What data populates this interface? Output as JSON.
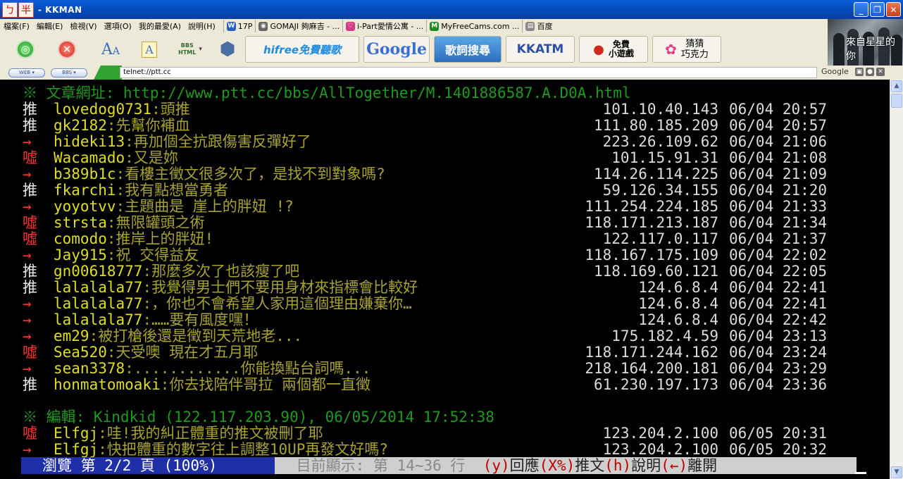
{
  "titlebar": {
    "ime": [
      "ㄅ",
      "半"
    ],
    "title": "- KKMAN",
    "buttons": [
      "_",
      "❐",
      "✕"
    ]
  },
  "menubar": {
    "items": [
      "檔案(F)",
      "編輯(E)",
      "檢視(V)",
      "選項(O)",
      "我的最愛(A)",
      "說明(H)"
    ],
    "favorites": [
      {
        "label": "17P",
        "icon": "W",
        "color": "#2a5fbf"
      },
      {
        "label": "GOMAJI 夠麻吉 - ...",
        "icon": "◉",
        "color": "#666666"
      },
      {
        "label": "i-Part愛情公寓 - ...",
        "icon": "♡",
        "color": "#d63b86"
      },
      {
        "label": "MyFreeCams.com ...",
        "icon": "M",
        "color": "#1f8a1f"
      },
      {
        "label": "百度",
        "icon": "▤",
        "color": "#888888"
      }
    ]
  },
  "toolbar": {
    "hifree": "hifree免費聽歌",
    "google": "Google",
    "lyrics": "歌詞搜尋",
    "kkatm": "KKATM",
    "game": "免費\n小遊戲",
    "guess": "猜猜\n巧克力",
    "bbs_html": "BBS\nHTML"
  },
  "promo": {
    "text": "來自星星的你"
  },
  "address": {
    "web_btn": "WEB ▾",
    "bbs_btn": "BBS ▾",
    "url": "telnet://ptt.cc",
    "search_label": "Google"
  },
  "terminal": {
    "url_line": "※ 文章網址: http://www.ptt.cc/bbs/AllTogether/M.1401886587.A.D0A.html",
    "pushes": [
      {
        "tag": "推",
        "user": "lovedog0731",
        "msg": ":頭推",
        "ip": "101.10.40.143",
        "dt": "06/04 20:57"
      },
      {
        "tag": "推",
        "user": "gk2182",
        "msg": ":先幫你補血",
        "ip": "111.80.185.209",
        "dt": "06/04 20:57"
      },
      {
        "tag": "→",
        "user": "hideki13",
        "msg": ":再加個全抗跟傷害反彈好了",
        "ip": "223.26.109.62",
        "dt": "06/04 21:06"
      },
      {
        "tag": "噓",
        "user": "Wacamado",
        "msg": ":又是妳",
        "ip": "101.15.91.31",
        "dt": "06/04 21:08"
      },
      {
        "tag": "→",
        "user": "b389b1c",
        "msg": ":看樓主徵文很多次了，是找不到對象嗎?",
        "ip": "114.26.114.225",
        "dt": "06/04 21:09"
      },
      {
        "tag": "推",
        "user": "fkarchi",
        "msg": ":我有點想當勇者",
        "ip": "59.126.34.155",
        "dt": "06/04 21:20"
      },
      {
        "tag": "→",
        "user": "yoyotvv",
        "msg": ":主題曲是 崖上的胖妞 !?",
        "ip": "111.254.224.185",
        "dt": "06/04 21:33"
      },
      {
        "tag": "噓",
        "user": "strsta",
        "msg": ":無限罐頭之術",
        "ip": "118.171.213.187",
        "dt": "06/04 21:34"
      },
      {
        "tag": "噓",
        "user": "comodo",
        "msg": ":推岸上的胖妞!",
        "ip": "122.117.0.117",
        "dt": "06/04 21:37"
      },
      {
        "tag": "→",
        "user": "Jay915",
        "msg": ":祝 交得益友",
        "ip": "118.167.175.109",
        "dt": "06/04 22:02"
      },
      {
        "tag": "推",
        "user": "gn00618777",
        "msg": ":那麼多次了也該瘦了吧",
        "ip": "118.169.60.121",
        "dt": "06/04 22:05"
      },
      {
        "tag": "推",
        "user": "lalalala77",
        "msg": ":我覺得男士們不要用身材來指標會比較好",
        "ip": "124.6.8.4",
        "dt": "06/04 22:41"
      },
      {
        "tag": "→",
        "user": "lalalala77",
        "msg": ":，你也不會希望人家用這個理由嫌棄你…",
        "ip": "124.6.8.4",
        "dt": "06/04 22:41"
      },
      {
        "tag": "→",
        "user": "lalalala77",
        "msg": ":……要有風度嘿！",
        "ip": "124.6.8.4",
        "dt": "06/04 22:42"
      },
      {
        "tag": "→",
        "user": "em29",
        "msg": ":被打槍後還是徵到天荒地老...",
        "ip": "175.182.4.59",
        "dt": "06/04 23:13"
      },
      {
        "tag": "噓",
        "user": "Sea520",
        "msg": ":天受噢 現在才五月耶",
        "ip": "118.171.244.162",
        "dt": "06/04 23:24"
      },
      {
        "tag": "→",
        "user": "sean3378",
        "msg": ":............你能換點台詞嗎...",
        "ip": "218.164.200.181",
        "dt": "06/04 23:29"
      },
      {
        "tag": "推",
        "user": "honmatomoaki",
        "msg": ":你去找陪伴哥拉 兩個都一直徵",
        "ip": "61.230.197.173",
        "dt": "06/04 23:36"
      }
    ],
    "edit_line": "※ 編輯: Kindkid (122.117.203.90), 06/05/2014 17:52:38",
    "pushes2": [
      {
        "tag": "噓",
        "user": "Elfgj",
        "msg": ":哇!我的糾正體重的推文被刪了耶",
        "ip": "123.204.2.100",
        "dt": "06/05 20:31"
      },
      {
        "tag": "→",
        "user": "Elfgj",
        "msg": ":快把體重的數字往上調整10UP再發文好嗎?",
        "ip": "123.204.2.100",
        "dt": "06/05 20:32"
      }
    ],
    "status_left": "瀏覽 第 2/2 頁 (100%)",
    "status_mid": " 目前顯示: 第 14~36 行  ",
    "status_keys": [
      {
        "k": "(y)",
        "d": "回應"
      },
      {
        "k": "(X%)",
        "d": "推文"
      },
      {
        "k": "(h)",
        "d": "說明"
      },
      {
        "k": "(←)",
        "d": "離開"
      }
    ]
  }
}
